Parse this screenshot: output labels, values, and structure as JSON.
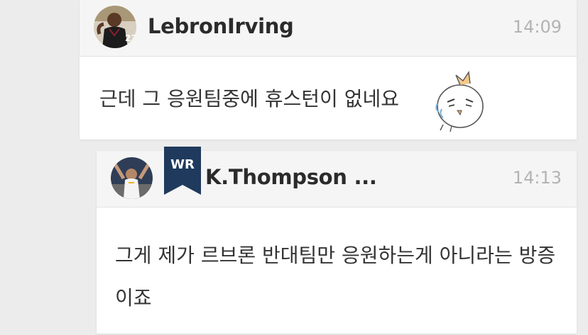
{
  "comments": [
    {
      "username": "LebronIrving",
      "time": "14:09",
      "avatar_icon": "basketball-player-avatar",
      "jersey_number": "23",
      "message": "근데 그 응원팀중에 휴스턴이 없네요",
      "sticker_icon": "sweating-bird-sticker"
    },
    {
      "username": "K.Thompson ...",
      "time": "14:13",
      "avatar_icon": "basketball-player-avatar",
      "badge": "WR",
      "badge_color": "#1f3a5c",
      "message": "그게 제가 르브론 반대팀만 응원하는게 아니라는 방증이죠"
    }
  ]
}
